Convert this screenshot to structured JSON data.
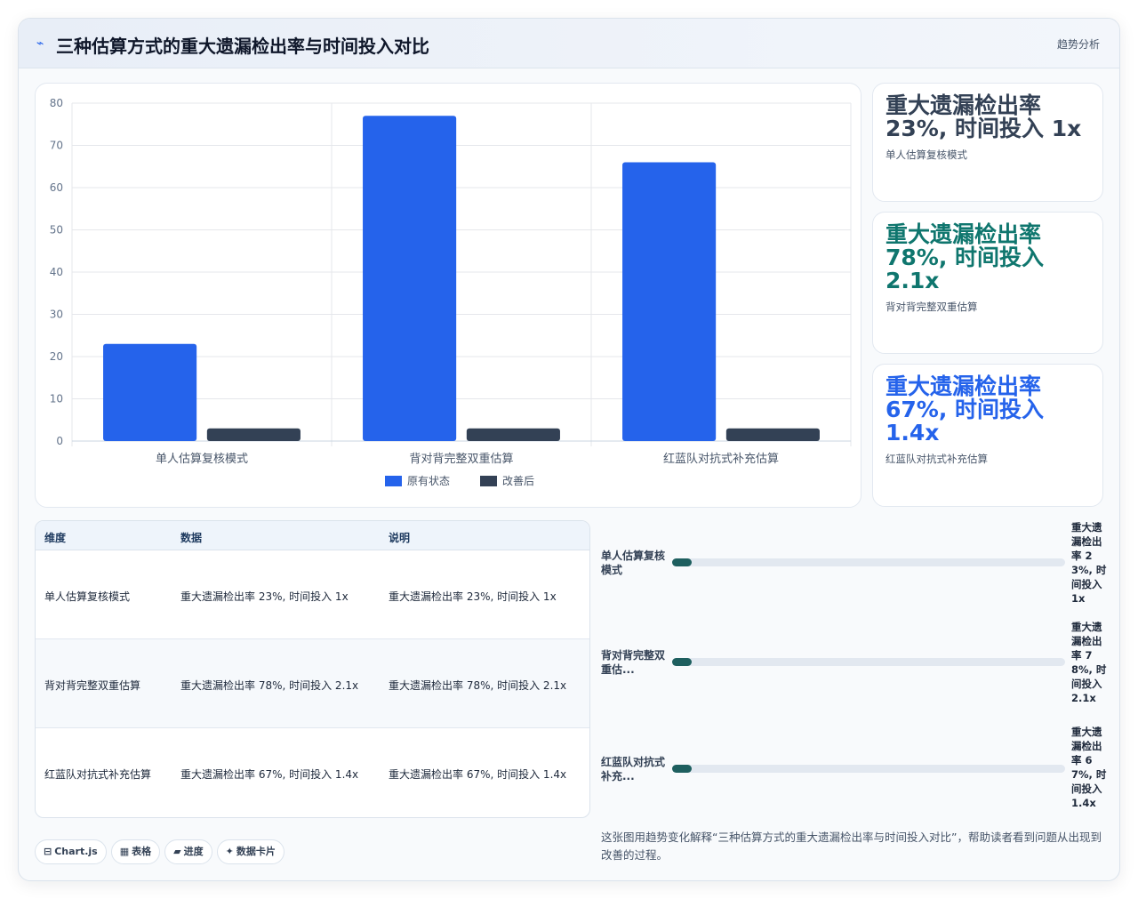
{
  "header": {
    "icon": "trend-icon",
    "title": "三种估算方式的重大遗漏检出率与时间投入对比",
    "tag": "趋势分析"
  },
  "chart_data": {
    "type": "bar",
    "categories": [
      "单人估算复核模式",
      "背对背完整双重估算",
      "红蓝队对抗式补充估算"
    ],
    "series": [
      {
        "name": "原有状态",
        "values": [
          23,
          77,
          66
        ],
        "color": "#2563eb"
      },
      {
        "name": "改善后",
        "values": [
          3,
          3,
          3
        ],
        "color": "#334155"
      }
    ],
    "ylim": [
      0,
      80
    ],
    "yticks": [
      0,
      10,
      20,
      30,
      40,
      50,
      60,
      70,
      80
    ],
    "grid": true,
    "legend": "bottom-center"
  },
  "stats": [
    {
      "value": "重大遗漏检出率 23%, 时间投入 1x",
      "label": "单人估算复核模式",
      "color": "#334155"
    },
    {
      "value": "重大遗漏检出率 78%, 时间投入 2.1x",
      "label": "背对背完整双重估算",
      "color": "#0f766e"
    },
    {
      "value": "重大遗漏检出率 67%, 时间投入 1.4x",
      "label": "红蓝队对抗式补充估算",
      "color": "#2563eb"
    }
  ],
  "table": {
    "headers": [
      "维度",
      "数据",
      "说明"
    ],
    "rows": [
      [
        "单人估算复核模式",
        "重大遗漏检出率 23%, 时间投入 1x",
        "重大遗漏检出率 23%, 时间投入 1x"
      ],
      [
        "背对背完整双重估算",
        "重大遗漏检出率 78%, 时间投入 2.1x",
        "重大遗漏检出率 78%, 时间投入 2.1x"
      ],
      [
        "红蓝队对抗式补充估算",
        "重大遗漏检出率 67%, 时间投入 1.4x",
        "重大遗漏检出率 67%, 时间投入 1.4x"
      ]
    ]
  },
  "progress": [
    {
      "label": "单人估算复核模式",
      "value": "重大遗漏检出率 23%, 时间投入 1x",
      "fraction": 0.05
    },
    {
      "label": "背对背完整双重估...",
      "value": "重大遗漏检出率 78%, 时间投入 2.1x",
      "fraction": 0.05
    },
    {
      "label": "红蓝队对抗式补充...",
      "value": "重大遗漏检出率 67%, 时间投入 1.4x",
      "fraction": 0.05
    }
  ],
  "pills": [
    {
      "icon": "⊟",
      "label": "Chart.js"
    },
    {
      "icon": "▦",
      "label": "表格"
    },
    {
      "icon": "▰",
      "label": "进度"
    },
    {
      "icon": "✦",
      "label": "数据卡片"
    }
  ],
  "note": "这张图用趋势变化解释“三种估算方式的重大遗漏检出率与时间投入对比”，帮助读者看到问题从出现到改善的过程。"
}
